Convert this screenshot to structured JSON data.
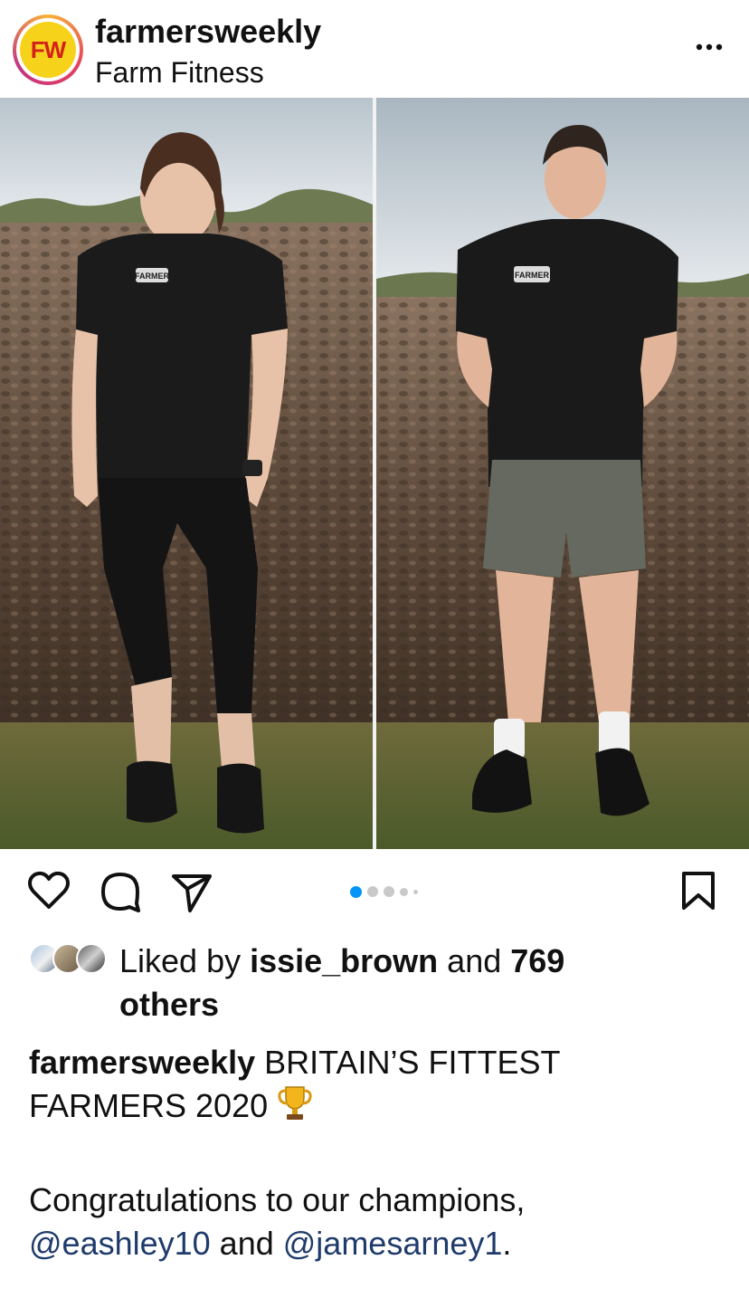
{
  "header": {
    "avatar_text": "FW",
    "username": "farmersweekly",
    "subtitle": "Farm Fitness",
    "more_icon": "more-horizontal-icon"
  },
  "post": {
    "carousel": {
      "total": 5,
      "active_index": 0
    },
    "shirt_text_1": "FARMER",
    "shirt_text_2": "FARMER"
  },
  "actions": {
    "like_icon": "heart-icon",
    "comment_icon": "comment-icon",
    "share_icon": "send-icon",
    "save_icon": "bookmark-icon"
  },
  "likes": {
    "prefix": "Liked by ",
    "user": "issie_brown",
    "middle": " and ",
    "count": "769",
    "suffix": "others"
  },
  "caption": {
    "username": "farmersweekly",
    "line1": " BRITAIN’S FITTEST",
    "line2": "FARMERS 2020 ",
    "body_prefix": "Congratulations to our champions,",
    "mention1": "@eashley10",
    "and_text": " and ",
    "mention2": "@jamesarney1",
    "end": "."
  },
  "colors": {
    "accent_blue": "#0095f6",
    "mention": "#1f3b6b",
    "logo_yellow": "#f7d21b",
    "logo_red": "#d3211b"
  }
}
